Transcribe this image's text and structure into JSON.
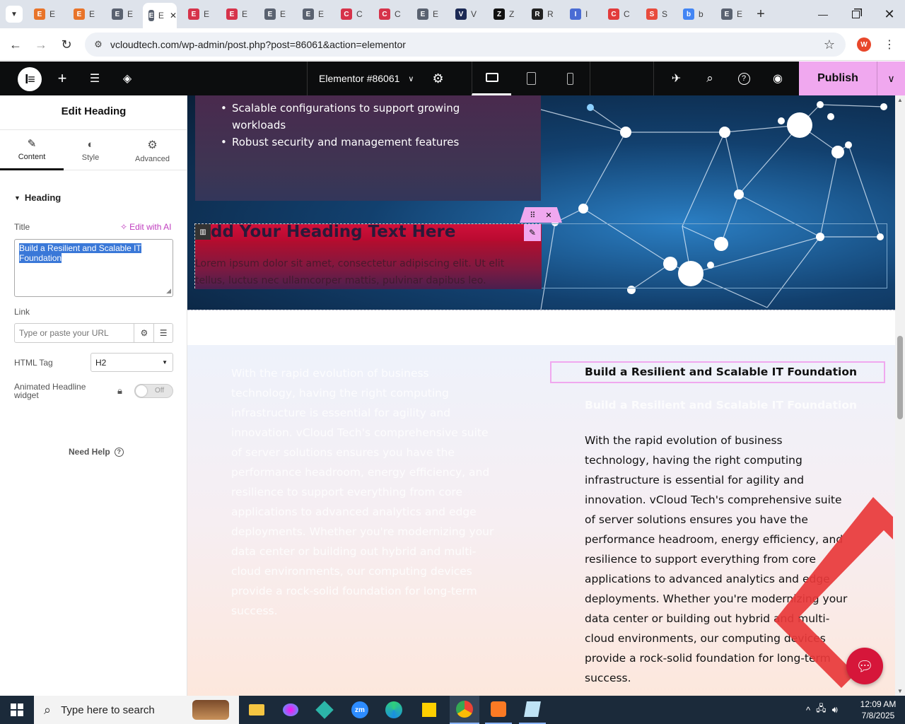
{
  "browser": {
    "tabs": [
      {
        "letter": "E",
        "color": "#e8742a"
      },
      {
        "letter": "E",
        "color": "#e8742a"
      },
      {
        "letter": "E",
        "color": "#5a6270"
      },
      {
        "letter": "E",
        "color": "#5a6270",
        "active": true
      },
      {
        "letter": "E",
        "color": "#d6334a"
      },
      {
        "letter": "E",
        "color": "#d6334a"
      },
      {
        "letter": "E",
        "color": "#5a6270"
      },
      {
        "letter": "E",
        "color": "#5a6270"
      },
      {
        "letter": "C",
        "color": "#d6334a"
      },
      {
        "letter": "C",
        "color": "#d6334a"
      },
      {
        "letter": "E",
        "color": "#5a6270"
      },
      {
        "letter": "V",
        "color": "#1c2a55"
      },
      {
        "letter": "Z",
        "color": "#111111"
      },
      {
        "letter": "R",
        "color": "#222222"
      },
      {
        "letter": "I",
        "color": "#4a6cd4"
      },
      {
        "letter": "C",
        "color": "#e23b3b"
      },
      {
        "letter": "S",
        "color": "#e84c3d"
      },
      {
        "letter": "b",
        "color": "#4285f4"
      },
      {
        "letter": "E",
        "color": "#5a6270"
      }
    ],
    "url": "vcloudtech.com/wp-admin/post.php?post=86061&action=elementor",
    "profile_initial": "W"
  },
  "elementor": {
    "document_title": "Elementor #86061",
    "publish_label": "Publish"
  },
  "panel": {
    "title": "Edit Heading",
    "tabs": [
      {
        "label": "Content",
        "icon": "pencil-icon"
      },
      {
        "label": "Style",
        "icon": "half-circle-icon"
      },
      {
        "label": "Advanced",
        "icon": "gear-icon"
      }
    ],
    "section_title": "Heading",
    "title_label": "Title",
    "edit_ai": "Edit with AI",
    "title_value": "Build a Resilient and Scalable IT Foundation",
    "link_label": "Link",
    "link_placeholder": "Type or paste your URL",
    "html_tag_label": "HTML Tag",
    "html_tag_value": "H2",
    "animated_label_1": "Animated Headline",
    "animated_label_2": "widget",
    "toggle_off": "Off",
    "need_help": "Need Help"
  },
  "canvas": {
    "bullets": [
      "Scalable configurations to support growing",
      "workloads",
      "Robust security and management features"
    ],
    "heading_placeholder": "dd Your Heading Text Here",
    "lorem_1": "Lorem ipsum dolor sit amet, consectetur adipiscing elit. Ut elit",
    "lorem_2": "tellus, luctus nec ullamcorper mattis, pulvinar dapibus leo.",
    "selected_heading": "Build a Resilient and Scalable IT Foundation",
    "ghost_heading": "Build a Resilient and Scalable IT Foundation",
    "paragraph_lines": [
      "With the rapid evolution of business",
      "technology, having the right computing",
      "infrastructure is essential for agility and",
      "innovation. vCloud Tech's comprehensive suite",
      "of server solutions ensures you have the",
      "performance headroom, energy efficiency, and",
      "resilience to support everything from core",
      "applications to advanced analytics and edge",
      "deployments. Whether you're modernizing your",
      "data center or building out hybrid and multi-",
      "cloud environments, our computing devices",
      "provide a rock-solid foundation for long-term",
      "success."
    ]
  },
  "taskbar": {
    "search_placeholder": "Type here to search",
    "time": "12:09 AM",
    "date": "7/8/2025"
  }
}
